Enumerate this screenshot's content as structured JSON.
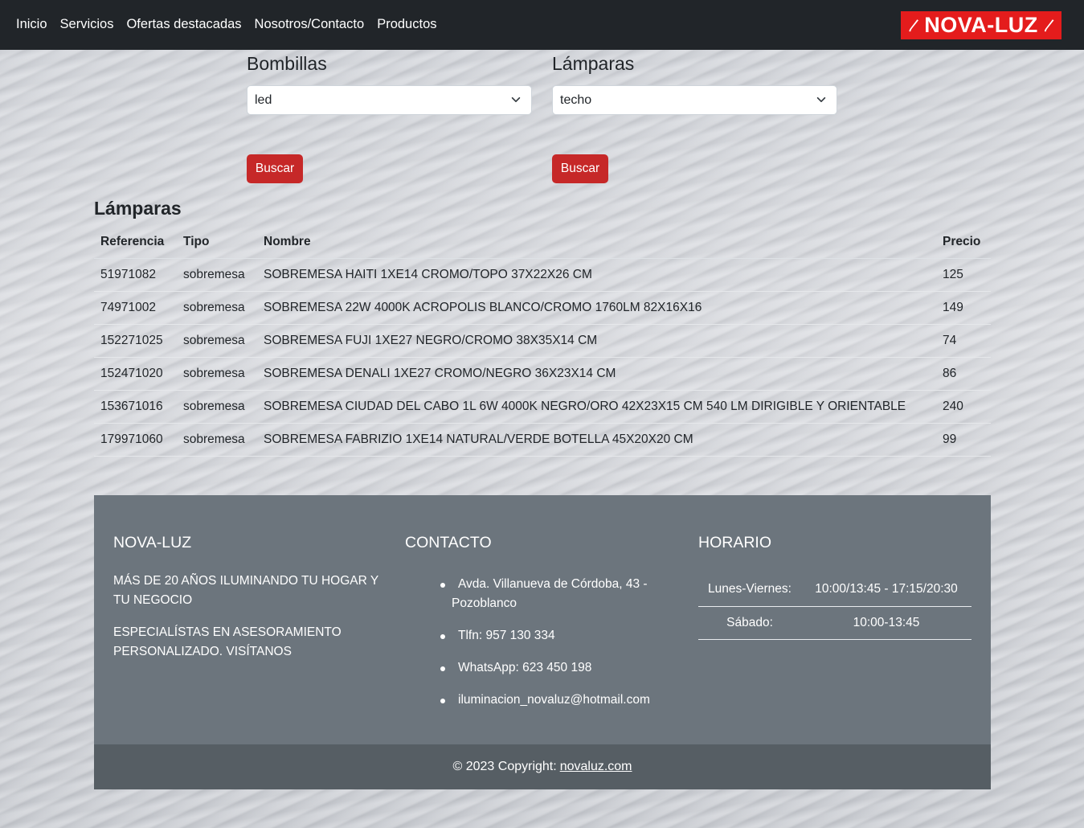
{
  "nav": {
    "links": [
      "Inicio",
      "Servicios",
      "Ofertas destacadas",
      "Nosotros/Contacto",
      "Productos"
    ],
    "brand": "NOVA-LUZ",
    "brand_color": "#e41c1c"
  },
  "filters": {
    "bombillas": {
      "title": "Bombillas",
      "selected": "led",
      "button": "Buscar"
    },
    "lamparas": {
      "title": "Lámparas",
      "selected": "techo",
      "button": "Buscar"
    }
  },
  "results": {
    "title": "Lámparas",
    "columns": [
      "Referencia",
      "Tipo",
      "Nombre",
      "Precio"
    ],
    "rows": [
      [
        "51971082",
        "sobremesa",
        "SOBREMESA HAITI 1XE14 CROMO/TOPO 37X22X26 CM",
        "125"
      ],
      [
        "74971002",
        "sobremesa",
        "SOBREMESA 22W 4000K ACROPOLIS BLANCO/CROMO 1760LM 82X16X16",
        "149"
      ],
      [
        "152271025",
        "sobremesa",
        "SOBREMESA FUJI 1XE27 NEGRO/CROMO 38X35X14 CM",
        "74"
      ],
      [
        "152471020",
        "sobremesa",
        "SOBREMESA DENALI 1XE27 CROMO/NEGRO 36X23X14 CM",
        "86"
      ],
      [
        "153671016",
        "sobremesa",
        "SOBREMESA CIUDAD DEL CABO 1L 6W 4000K NEGRO/ORO 42X23X15 CM 540 LM DIRIGIBLE Y ORIENTABLE",
        "240"
      ],
      [
        "179971060",
        "sobremesa",
        "SOBREMESA FABRIZIO 1XE14 NATURAL/VERDE BOTELLA 45X20X20 CM",
        "99"
      ]
    ]
  },
  "footer": {
    "about": {
      "heading": "NOVA-LUZ",
      "lines": [
        "MÁS DE 20 AÑOS ILUMINANDO TU HOGAR Y TU NEGOCIO",
        "ESPECIALÍSTAS EN ASESORAMIENTO PERSONALIZADO. VISÍTANOS"
      ]
    },
    "contact": {
      "heading": "CONTACTO",
      "items": [
        "Avda. Villanueva de Córdoba, 43 - Pozoblanco",
        "Tlfn: 957 130 334",
        "WhatsApp: 623 450 198",
        "iluminacion_novaluz@hotmail.com"
      ]
    },
    "hours": {
      "heading": "HORARIO",
      "rows": [
        [
          "Lunes-Viernes:",
          "10:00/13:45 - 17:15/20:30"
        ],
        [
          "Sábado:",
          "10:00-13:45"
        ]
      ]
    },
    "copyright_text": "© 2023 Copyright:",
    "copyright_link": "novaluz.com"
  }
}
